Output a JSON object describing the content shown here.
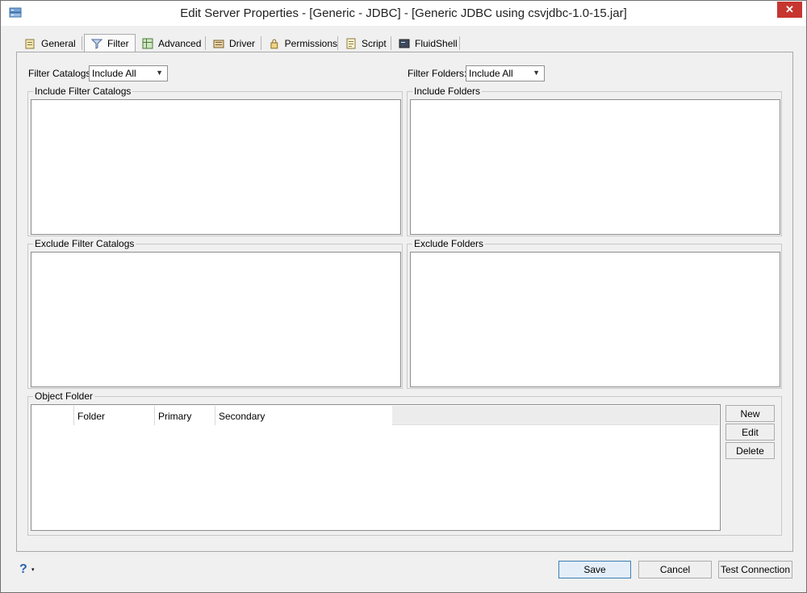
{
  "window": {
    "title": "Edit Server Properties - [Generic - JDBC] - [Generic JDBC using csvjdbc-1.0-15.jar]",
    "close_glyph": "✕"
  },
  "tabs": [
    {
      "label": "General",
      "icon": "general-properties-icon"
    },
    {
      "label": "Filter",
      "icon": "filter-icon",
      "active": true
    },
    {
      "label": "Advanced",
      "icon": "advanced-settings-icon"
    },
    {
      "label": "Driver",
      "icon": "driver-icon"
    },
    {
      "label": "Permissions",
      "icon": "permissions-icon"
    },
    {
      "label": "Script",
      "icon": "script-icon"
    },
    {
      "label": "FluidShell",
      "icon": "fluidshell-icon"
    }
  ],
  "filter": {
    "catalogs_label": "Filter Catalogs",
    "catalogs_value": "Include All",
    "folders_label": "Filter Folders:",
    "folders_value": "Include All"
  },
  "groups": {
    "include_catalogs": "Include Filter Catalogs",
    "include_folders": "Include Folders",
    "exclude_catalogs": "Exclude Filter Catalogs",
    "exclude_folders": "Exclude Folders",
    "object_folder": "Object Folder"
  },
  "object_table": {
    "columns": [
      "",
      "Folder",
      "Primary",
      "Secondary"
    ]
  },
  "side_buttons": {
    "new": "New",
    "edit": "Edit",
    "delete": "Delete"
  },
  "footer": {
    "help_glyph": "?",
    "help_caret": "▾",
    "save": "Save",
    "cancel": "Cancel",
    "test_connection": "Test Connection"
  },
  "colors": {
    "close_button": "#c7352f",
    "primary_button_border": "#3c7fb1",
    "help_icon": "#2a63b0"
  }
}
